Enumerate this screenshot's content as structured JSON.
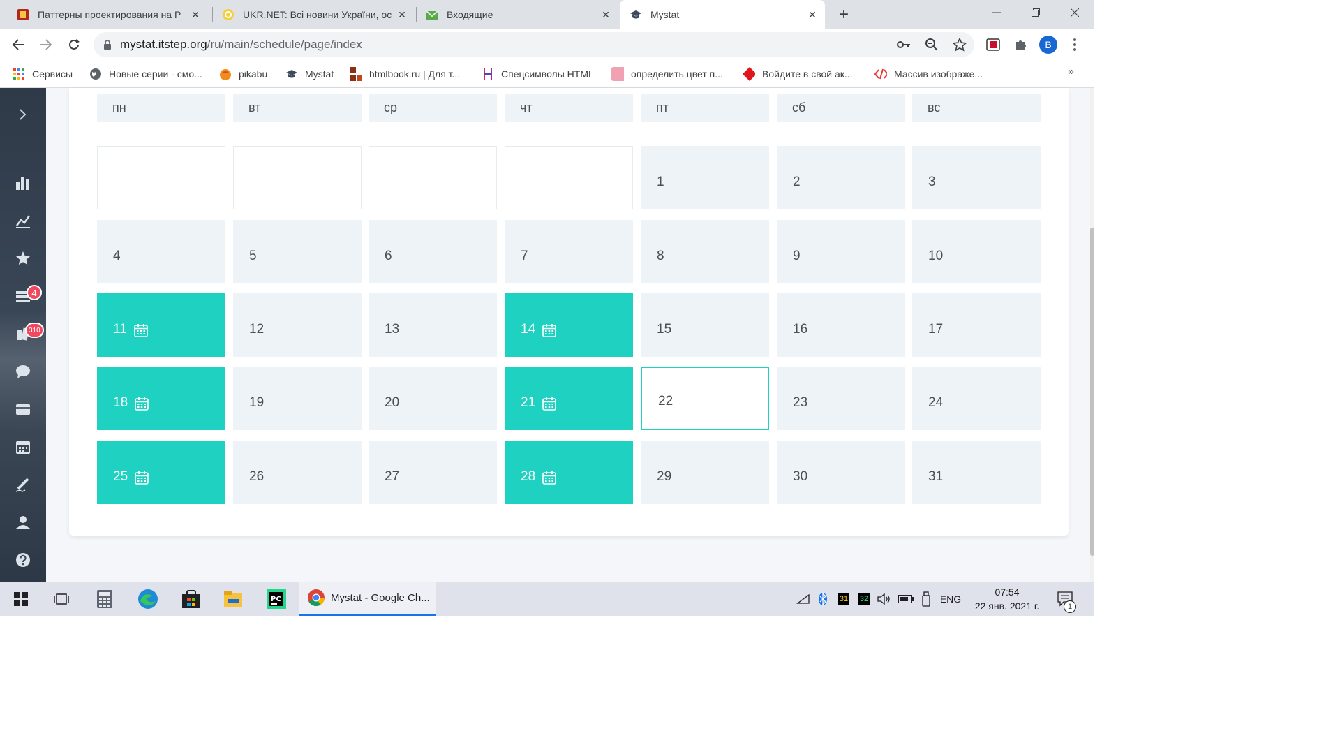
{
  "browser": {
    "tabs": [
      {
        "title": "Паттерны проектирования на P",
        "icon": "pdf-doc-icon"
      },
      {
        "title": "UKR.NET: Всі новини України, ос",
        "icon": "ukrnet-icon"
      },
      {
        "title": "Входящие",
        "icon": "mail-envelope-icon"
      },
      {
        "title": "Mystat",
        "icon": "graduation-cap-icon",
        "active": true
      }
    ],
    "url_host": "mystat.itstep.org",
    "url_path": "/ru/main/schedule/page/index",
    "profile_initial": "B",
    "bookmarks": [
      {
        "label": "Сервисы",
        "icon": "apps-grid-icon"
      },
      {
        "label": "Новые серии - смо...",
        "icon": "globe-icon"
      },
      {
        "label": "pikabu",
        "icon": "pikabu-icon"
      },
      {
        "label": "Mystat",
        "icon": "graduation-cap-icon"
      },
      {
        "label": "htmlbook.ru | Для т...",
        "icon": "htmlbook-icon"
      },
      {
        "label": "Спецсимволы HTML",
        "icon": "h-letter-icon"
      },
      {
        "label": "определить цвет п...",
        "icon": "pink-square-icon"
      },
      {
        "label": "Войдите в свой ак...",
        "icon": "red-diamond-icon"
      },
      {
        "label": "Массив изображе...",
        "icon": "code-icon"
      }
    ]
  },
  "sidebar": {
    "badges": {
      "tasks": "4",
      "homework": "310"
    }
  },
  "calendar": {
    "weekdays": [
      "пн",
      "вт",
      "ср",
      "чт",
      "пт",
      "сб",
      "вс"
    ],
    "days": [
      "",
      "",
      "",
      "",
      "1",
      "2",
      "3",
      "4",
      "5",
      "6",
      "7",
      "8",
      "9",
      "10",
      "11",
      "12",
      "13",
      "14",
      "15",
      "16",
      "17",
      "18",
      "19",
      "20",
      "21",
      "22",
      "23",
      "24",
      "25",
      "26",
      "27",
      "28",
      "29",
      "30",
      "31"
    ],
    "lesson_days": [
      "11",
      "14",
      "18",
      "21",
      "25",
      "28"
    ],
    "today": "22",
    "colors": {
      "lesson": "#1fd1c1",
      "cell": "#eef3f7",
      "text": "#4a4f55"
    }
  },
  "taskbar": {
    "active_app_label": "Mystat - Google Ch...",
    "tray_badge_1": "31",
    "tray_badge_2": "32",
    "language": "ENG",
    "time": "07:54",
    "date": "22 янв. 2021 г.",
    "notifications": "1"
  }
}
